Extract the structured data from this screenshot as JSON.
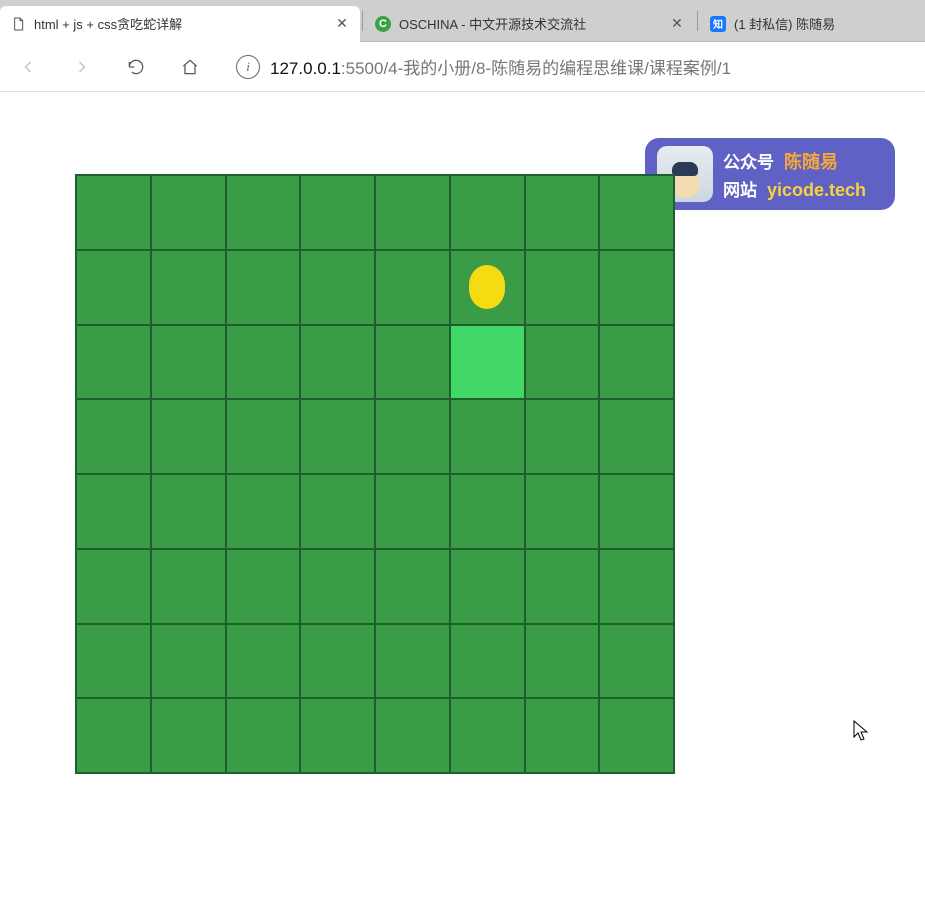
{
  "browser": {
    "tabs": [
      {
        "title": "html + js + css贪吃蛇详解",
        "favicon": "document-icon",
        "active": true
      },
      {
        "title": "OSCHINA - 中文开源技术交流社",
        "favicon": "oschina-icon",
        "active": false
      },
      {
        "title": "(1 封私信) 陈随易",
        "favicon": "zhihu-icon",
        "active": false
      }
    ],
    "url": {
      "host": "127.0.0.1",
      "port": ":5500",
      "path": "/4-我的小册/8-陈随易的编程思维课/课程案例/1"
    }
  },
  "badge": {
    "label1": "公众号",
    "value1": "陈随易",
    "label2": "网站",
    "value2": "yicode.tech"
  },
  "game": {
    "grid": {
      "rows": 8,
      "cols": 8
    },
    "colors": {
      "board": "#3b9c47",
      "snake": "#42d867",
      "food": "#f5db11",
      "gridline": "#1e5e2f"
    },
    "snake": [
      {
        "row": 2,
        "col": 5
      }
    ],
    "food": {
      "row": 1,
      "col": 5
    }
  }
}
